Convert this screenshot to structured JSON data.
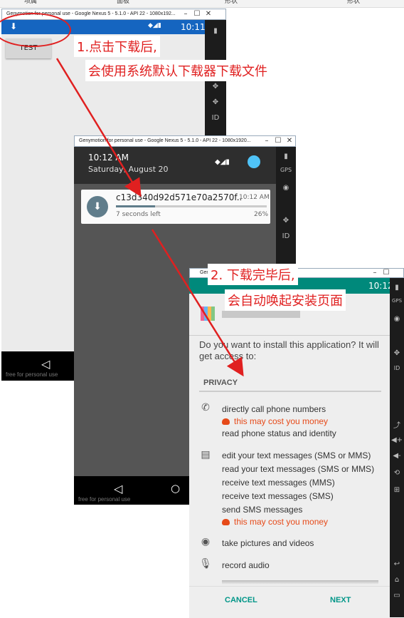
{
  "top_strip": {
    "tabs": [
      "项属",
      "面板",
      "形状",
      "形状"
    ]
  },
  "window1": {
    "title": "Genymotion for personal use - Google Nexus 5 - 5.1.0 - API 22 - 1080x192...",
    "status_time": "10:11",
    "test_button": "TEST",
    "watermark": "free for personal use"
  },
  "window2": {
    "title": "Genymotion for personal use - Google Nexus 5 - 5.1.0 - API 22 - 1080x1920...",
    "time": "10:12 AM",
    "date": "Saturday, August 20",
    "notification": {
      "filename": "c13d340d92d571e70a2570f..",
      "time": "10:12 AM",
      "eta": "7 seconds left",
      "percent": "26%",
      "progress": 0.26
    },
    "watermark": "free for personal use"
  },
  "window3": {
    "title": "Gen",
    "status_time": "10:12",
    "question": "Do you want to install this application? It will get access to:",
    "section_header": "PRIVACY",
    "groups": [
      {
        "icon": "phone-icon",
        "lines": [
          "directly call phone numbers"
        ],
        "warn": "this may cost you money",
        "after": [
          "read phone status and identity"
        ]
      },
      {
        "icon": "message-icon",
        "lines": [
          "edit your text messages (SMS or MMS)",
          "read your text messages (SMS or MMS)",
          "receive text messages (MMS)",
          "receive text messages (SMS)",
          "send SMS messages"
        ],
        "warn": "this may cost you money",
        "after": []
      },
      {
        "icon": "camera-icon",
        "lines": [
          "take pictures and videos"
        ],
        "warn": "",
        "after": []
      },
      {
        "icon": "microphone-icon",
        "lines": [
          "record audio"
        ],
        "warn": "",
        "after": []
      }
    ],
    "cancel_label": "CANCEL",
    "next_label": "NEXT"
  },
  "annotations": {
    "step1_line1": "1.点击下载后,",
    "step1_line2": "会使用系统默认下载器下载文件",
    "step2_line1": "2. 下载完毕后,",
    "step2_line2": "会自动唤起安装页面"
  },
  "colors": {
    "annotation": "#e02020",
    "accent": "#009688",
    "warning": "#e64a19",
    "notif_icon": "#607d8b"
  }
}
